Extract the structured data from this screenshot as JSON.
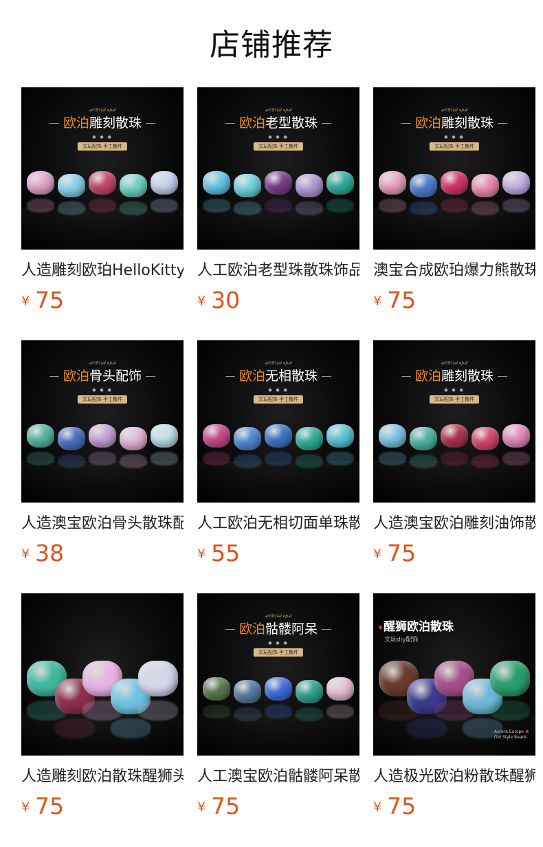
{
  "page_title": "店铺推荐",
  "products": [
    {
      "name": "人造雕刻欧珀HelloKitty猫头散珠",
      "currency": "¥",
      "price": "75",
      "image": {
        "style": "banner",
        "eyebrow": "artificial opal",
        "banner_orange": "欧泊",
        "banner_white": "雕刻散珠",
        "pill": "文玩配饰 手工散件",
        "beads": [
          "#e9a6cf",
          "#8ad2ee",
          "#c74a6e",
          "#6fd6c6",
          "#c7d7f4"
        ]
      }
    },
    {
      "name": "人工欧泊老型珠散珠饰品",
      "currency": "¥",
      "price": "30",
      "image": {
        "style": "banner",
        "eyebrow": "artificial opal",
        "banner_orange": "欧泊",
        "banner_white": "老型散珠",
        "pill": "文玩配饰 手工散件",
        "beads": [
          "#66c9ee",
          "#6fd5e0",
          "#7b3f8e",
          "#b59ad6",
          "#2fb1a0"
        ]
      }
    },
    {
      "name": "澳宝合成欧珀爆力熊散珠",
      "currency": "¥",
      "price": "75",
      "image": {
        "style": "banner",
        "eyebrow": "artificial opal",
        "banner_orange": "欧泊",
        "banner_white": "雕刻散珠",
        "pill": "文玩配饰 手工散件",
        "beads": [
          "#f0a3c4",
          "#4d7fd0",
          "#d8346e",
          "#ee8cb1",
          "#c9b4ea"
        ]
      }
    },
    {
      "name": "人造澳宝欧泊骨头散珠配饰",
      "currency": "¥",
      "price": "38",
      "image": {
        "style": "banner",
        "eyebrow": "artificial opal",
        "banner_orange": "欧泊",
        "banner_white": "骨头配饰",
        "pill": "文玩配饰 手工散件",
        "beads": [
          "#57b9a4",
          "#4b6fc4",
          "#c9a5d8",
          "#e7b6d8",
          "#bde4ee"
        ]
      }
    },
    {
      "name": "人工欧泊无相切面单珠散珠",
      "currency": "¥",
      "price": "55",
      "image": {
        "style": "banner",
        "eyebrow": "artificial opal",
        "banner_orange": "欧泊",
        "banner_white": "无相散珠",
        "pill": "文玩配饰 手工散件",
        "beads": [
          "#c94b8b",
          "#4f8ad6",
          "#3b79c9",
          "#2fae9a",
          "#5bc8d8"
        ]
      }
    },
    {
      "name": "人造澳宝欧泊雕刻油饰散珠",
      "currency": "¥",
      "price": "75",
      "image": {
        "style": "banner",
        "eyebrow": "artificial opal",
        "banner_orange": "欧泊",
        "banner_white": "雕刻散珠",
        "pill": "文玩配饰 手工散件",
        "beads": [
          "#7fc8ea",
          "#4fb7a8",
          "#b0344e",
          "#d7466c",
          "#e78dbd"
        ]
      }
    },
    {
      "name": "人造雕刻欧泊散珠醒狮头",
      "currency": "¥",
      "price": "75",
      "image": {
        "style": "photo",
        "beads": [
          "#3fb89e",
          "#8a2f4d",
          "#e7b3e2",
          "#6ec3e3",
          "#d4d6ee"
        ]
      }
    },
    {
      "name": "人工澳宝欧泊骷髅阿呆散珠",
      "currency": "¥",
      "price": "75",
      "image": {
        "style": "banner",
        "eyebrow": "artificial opal",
        "banner_orange": "欧泊",
        "banner_white": "骷髅阿呆",
        "pill": "文玩配饰 手工散件",
        "beads": [
          "#5b7a4e",
          "#587ca1",
          "#3f6ee0",
          "#2fa38e",
          "#e9c1d6"
        ]
      }
    },
    {
      "name": "人造极光欧泊粉散珠醒狮",
      "currency": "¥",
      "price": "75",
      "image": {
        "style": "titled",
        "title": "醒狮欧泊散珠",
        "subtitle": "文玩diy配饰",
        "corner_line1": "Aurora Europe",
        "corner_line2": "Old Style Beads",
        "beads": [
          "#6b3a2e",
          "#3a3a8e",
          "#a64f8b",
          "#6fb7d8",
          "#2b9e6f"
        ]
      }
    }
  ]
}
